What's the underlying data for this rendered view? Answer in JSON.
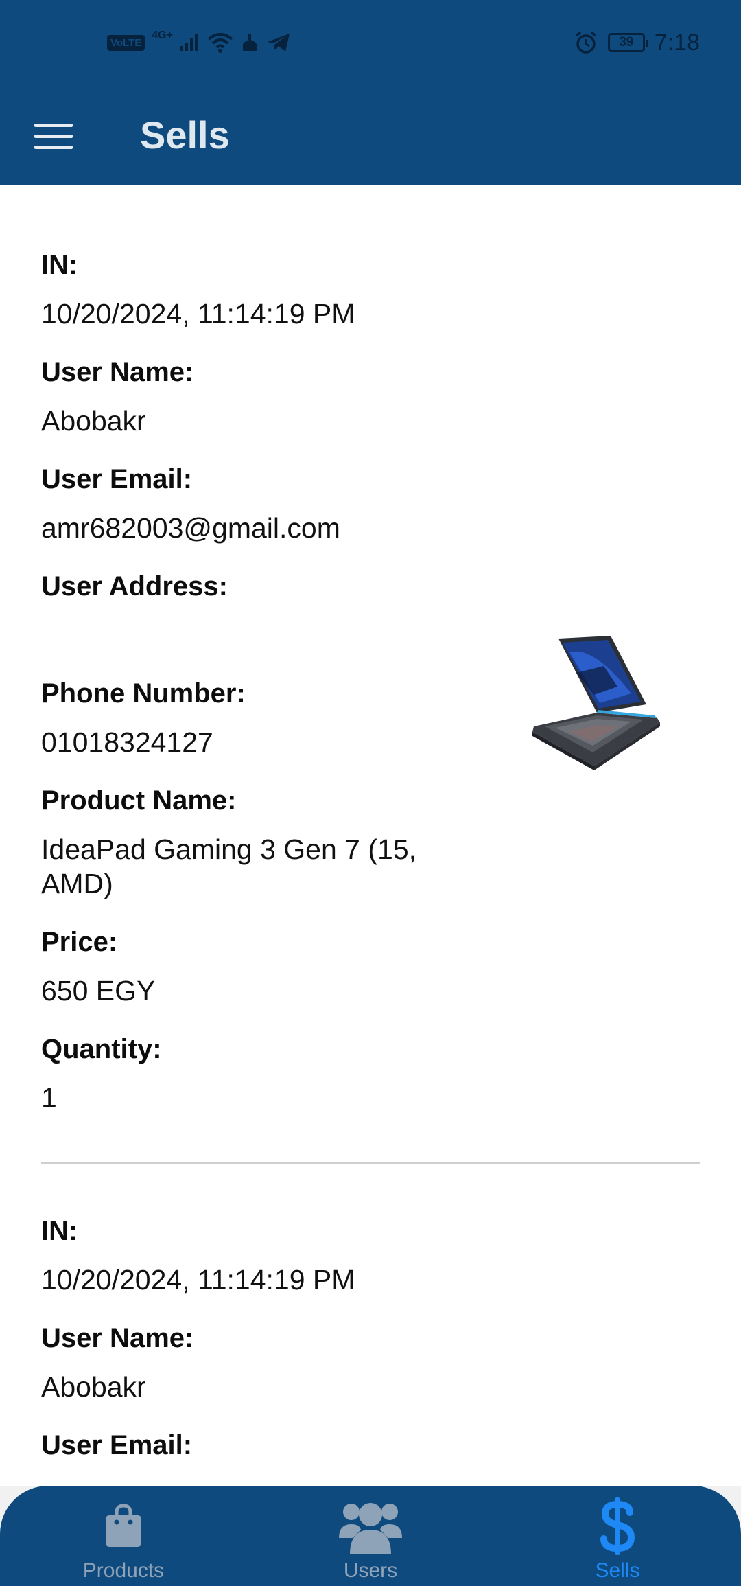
{
  "status_bar": {
    "volte": "VoLTE",
    "network": "4G+",
    "battery": "39",
    "time": "7:18"
  },
  "app_bar": {
    "title": "Sells"
  },
  "records": [
    {
      "fields": [
        {
          "label": "IN:",
          "value": "10/20/2024, 11:14:19 PM"
        },
        {
          "label": "User Name:",
          "value": "Abobakr"
        },
        {
          "label": "User Email:",
          "value": "amr682003@gmail.com"
        },
        {
          "label": "User Address:",
          "value": ""
        },
        {
          "label": "Phone Number:",
          "value": "01018324127"
        },
        {
          "label": "Product Name:",
          "value": "IdeaPad Gaming 3 Gen 7 (15, AMD)"
        },
        {
          "label": "Price:",
          "value": "650 EGY"
        },
        {
          "label": "Quantity:",
          "value": "1"
        }
      ]
    },
    {
      "fields": [
        {
          "label": "IN:",
          "value": "10/20/2024, 11:14:19 PM"
        },
        {
          "label": "User Name:",
          "value": "Abobakr"
        },
        {
          "label": "User Email:",
          "value": ""
        }
      ]
    }
  ],
  "bottom_nav": {
    "items": [
      {
        "label": "Products",
        "icon": "shopping-bag-icon"
      },
      {
        "label": "Users",
        "icon": "users-icon"
      },
      {
        "label": "Sells",
        "icon": "dollar-icon"
      }
    ],
    "active": "Sells"
  },
  "colors": {
    "primary": "#0e4a7d",
    "active_nav": "#1e88f5",
    "inactive_nav": "#8fa3b8"
  }
}
